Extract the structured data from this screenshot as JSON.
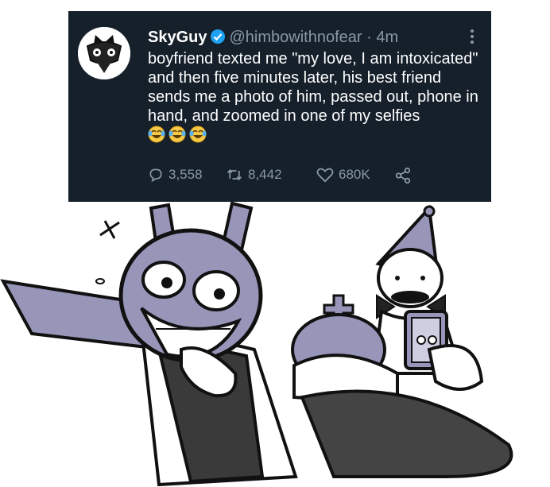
{
  "tweet": {
    "display_name": "SkyGuy",
    "handle": "@himbowithnofear",
    "separator": "·",
    "time": "4m",
    "text": "boyfriend texted me \"my love, I am intoxicated\" and then five minutes later, his best friend sends me a photo of him, passed out, phone in hand, and zoomed in one of my selfies",
    "emoji_icon": "laughing-crying-emoji",
    "replies": "3,558",
    "retweets": "8,442",
    "likes": "680K"
  },
  "colors": {
    "tweet_bg": "#15202b",
    "muted": "#8899a6",
    "verified": "#1da1f2",
    "character_purple": "#9795b8"
  }
}
